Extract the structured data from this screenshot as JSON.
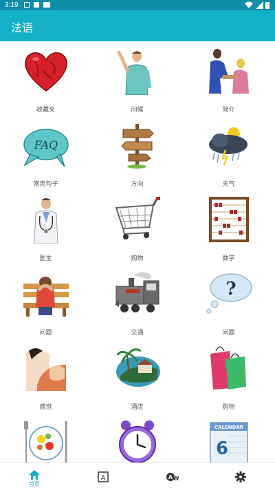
{
  "status_bar": {
    "time": "3:19"
  },
  "app_bar": {
    "title": "法语"
  },
  "categories": [
    {
      "label": "收藏夹",
      "icon": "heart-icon"
    },
    {
      "label": "问候",
      "icon": "waving-man-icon"
    },
    {
      "label": "简介",
      "icon": "handshake-icon"
    },
    {
      "label": "常用句子",
      "icon": "faq-speech-bubble-icon"
    },
    {
      "label": "方向",
      "icon": "signpost-icon"
    },
    {
      "label": "天气",
      "icon": "storm-cloud-icon"
    },
    {
      "label": "医生",
      "icon": "doctor-icon"
    },
    {
      "label": "购物",
      "icon": "shopping-cart-icon"
    },
    {
      "label": "数字",
      "icon": "abacus-icon"
    },
    {
      "label": "问题",
      "icon": "worried-person-bench-icon"
    },
    {
      "label": "交通",
      "icon": "train-icon"
    },
    {
      "label": "问题",
      "icon": "question-cloud-icon"
    },
    {
      "label": "感觉",
      "icon": "feelings-icon"
    },
    {
      "label": "酒店",
      "icon": "island-hotel-icon"
    },
    {
      "label": "购物",
      "icon": "shopping-bags-icon"
    },
    {
      "label": "",
      "icon": "plate-food-icon"
    },
    {
      "label": "",
      "icon": "alarm-clock-icon"
    },
    {
      "label": "",
      "icon": "calendar-icon"
    }
  ],
  "calendar_icon_text": {
    "header": "CALENDAR",
    "day": "6"
  },
  "bottom_nav": [
    {
      "icon": "home-icon",
      "label": "首页",
      "active": true
    },
    {
      "icon": "letter-a-icon",
      "label": "",
      "active": false
    },
    {
      "icon": "translate-icon",
      "label": "",
      "active": false
    },
    {
      "icon": "gear-icon",
      "label": "",
      "active": false
    }
  ],
  "colors": {
    "accent": "#13b0c8",
    "status_bar": "#0f8ea8"
  }
}
